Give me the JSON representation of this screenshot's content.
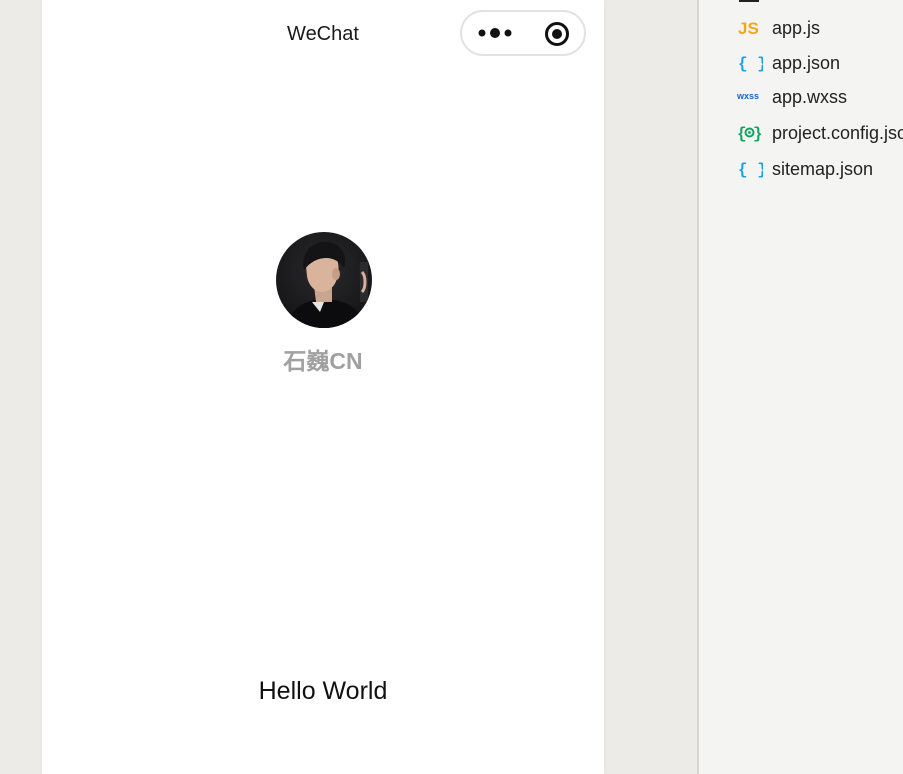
{
  "navbar": {
    "title": "WeChat"
  },
  "capsule": {
    "more_icon": "more-dots-icon",
    "close_icon": "target-close-icon"
  },
  "profile": {
    "nickname": "石巍CN",
    "avatar": "user-avatar-photo"
  },
  "content": {
    "text": "Hello World"
  },
  "file_tree": {
    "items": [
      {
        "name": "app.js",
        "icon": "js-file-icon",
        "color": "#f0a81c"
      },
      {
        "name": "app.json",
        "icon": "json-file-icon",
        "color": "#1ba1e2"
      },
      {
        "name": "app.wxss",
        "icon": "wxss-file-icon",
        "color": "#1c64c8"
      },
      {
        "name": "project.config.json",
        "icon": "config-json-file-icon",
        "color": "#12a561"
      },
      {
        "name": "sitemap.json",
        "icon": "json-file-icon",
        "color": "#1ba1e2"
      }
    ]
  },
  "colors": {
    "simulator_bg": "#ecebe7",
    "panel_bg": "#f4f5f3",
    "nickname": "#a0a0a0"
  }
}
